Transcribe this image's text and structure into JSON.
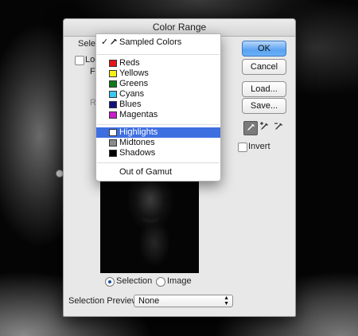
{
  "dialog": {
    "title": "Color Range"
  },
  "left": {
    "select_partial": "Select",
    "localized_partial": "Loc",
    "fuzziness_partial": "Fu",
    "range_partial": "Ra"
  },
  "menu": {
    "items": [
      {
        "label": "Sampled Colors",
        "checked": true,
        "icon": "eyedropper-icon"
      },
      {
        "label": "Reds",
        "color": "#e8141c"
      },
      {
        "label": "Yellows",
        "color": "#f6f016"
      },
      {
        "label": "Greens",
        "color": "#0e7a1a"
      },
      {
        "label": "Cyans",
        "color": "#3cc8f0"
      },
      {
        "label": "Blues",
        "color": "#12127a"
      },
      {
        "label": "Magentas",
        "color": "#c81ec8"
      },
      {
        "label": "Highlights",
        "color": "#ffffff",
        "highlighted": true
      },
      {
        "label": "Midtones",
        "color": "#8c8c8c"
      },
      {
        "label": "Shadows",
        "color": "#000000"
      },
      {
        "label": "Out of Gamut"
      }
    ],
    "checkmark": "✓"
  },
  "buttons": {
    "ok": "OK",
    "cancel": "Cancel",
    "load": "Load...",
    "save": "Save..."
  },
  "invert": {
    "label": "Invert",
    "checked": false
  },
  "radios": {
    "selection": "Selection",
    "image": "Image",
    "selected": "selection"
  },
  "preview": {
    "label": "Selection Preview:",
    "value": "None"
  },
  "colors": {
    "accent": "#3e6fe0",
    "ok_button": "#5ba3f1"
  }
}
